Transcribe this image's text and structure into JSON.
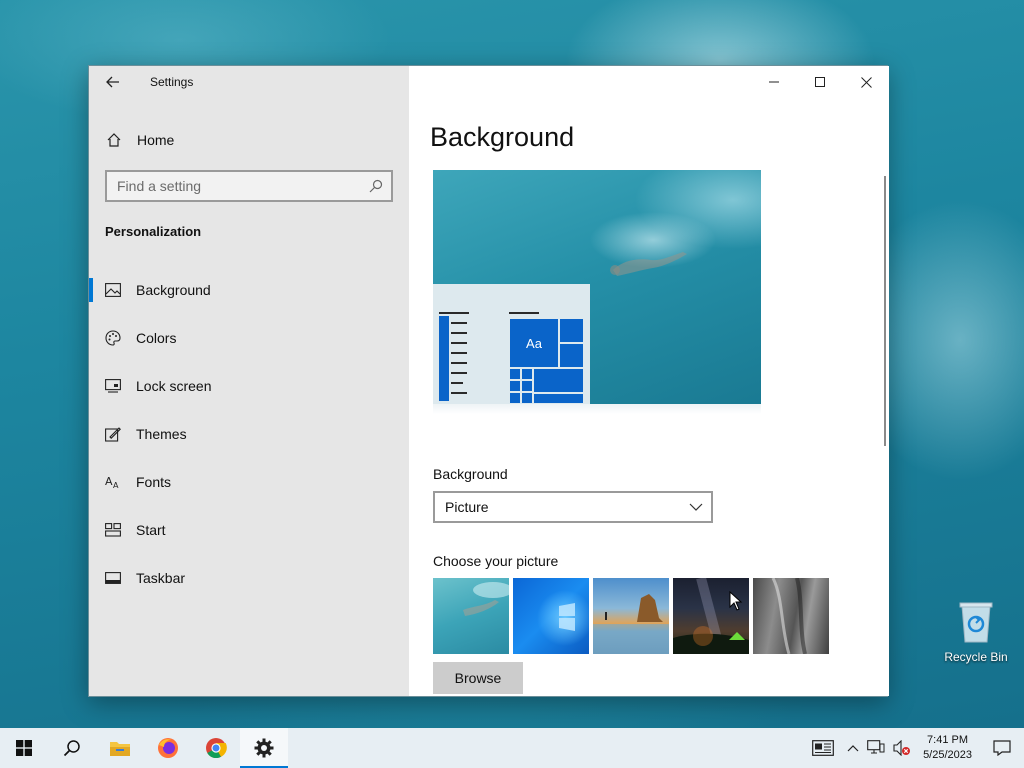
{
  "window": {
    "app_title": "Settings",
    "home_label": "Home",
    "search_placeholder": "Find a setting",
    "section_title": "Personalization",
    "nav_items": [
      {
        "label": "Background",
        "icon": "picture-icon",
        "active": true
      },
      {
        "label": "Colors",
        "icon": "palette-icon",
        "active": false
      },
      {
        "label": "Lock screen",
        "icon": "lock-screen-icon",
        "active": false
      },
      {
        "label": "Themes",
        "icon": "themes-icon",
        "active": false
      },
      {
        "label": "Fonts",
        "icon": "fonts-icon",
        "active": false
      },
      {
        "label": "Start",
        "icon": "start-icon",
        "active": false
      },
      {
        "label": "Taskbar",
        "icon": "taskbar-icon",
        "active": false
      }
    ]
  },
  "main": {
    "page_title": "Background",
    "preview_tile_text": "Aa",
    "background_label": "Background",
    "background_value": "Picture",
    "choose_picture_label": "Choose your picture",
    "thumbnails": [
      "underwater-swimmer",
      "windows-blue-logo",
      "beach-rock-arch",
      "night-sky-tent",
      "rock-cliff"
    ],
    "browse_label": "Browse"
  },
  "desktop": {
    "recycle_bin_label": "Recycle Bin"
  },
  "taskbar": {
    "apps": [
      "start-icon",
      "search-icon",
      "file-explorer-icon",
      "firefox-icon",
      "chrome-icon",
      "settings-icon"
    ],
    "active_app": "settings-icon",
    "clock_time": "7:41 PM",
    "clock_date": "5/25/2023"
  },
  "colors": {
    "accent": "#0078d4",
    "sidebar_bg": "#e6e6e6",
    "taskbar_bg": "#e7eef3"
  }
}
